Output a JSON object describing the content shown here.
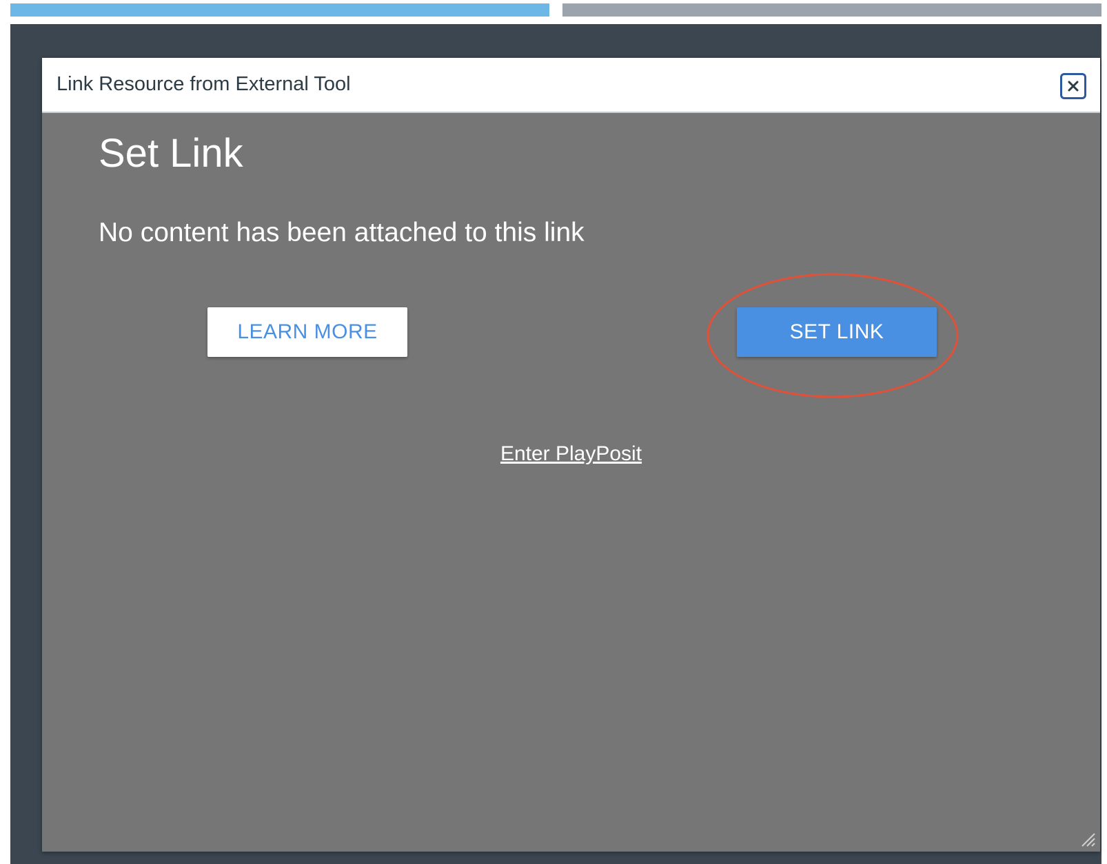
{
  "progress": {
    "segments": [
      {
        "state": "complete",
        "color": "#6db7e6"
      },
      {
        "state": "pending",
        "color": "#9ba3ad"
      }
    ]
  },
  "dialog": {
    "title": "Link Resource from External Tool",
    "close_icon": "close-icon"
  },
  "content": {
    "heading": "Set Link",
    "message": "No content has been attached to this link",
    "learn_more_label": "LEARN MORE",
    "set_link_label": "SET LINK",
    "enter_link_label": "Enter PlayPosit"
  },
  "colors": {
    "accent": "#4a90e2",
    "body_background": "#767676",
    "backdrop": "#3b4650",
    "highlight_ring": "#e0513a"
  }
}
